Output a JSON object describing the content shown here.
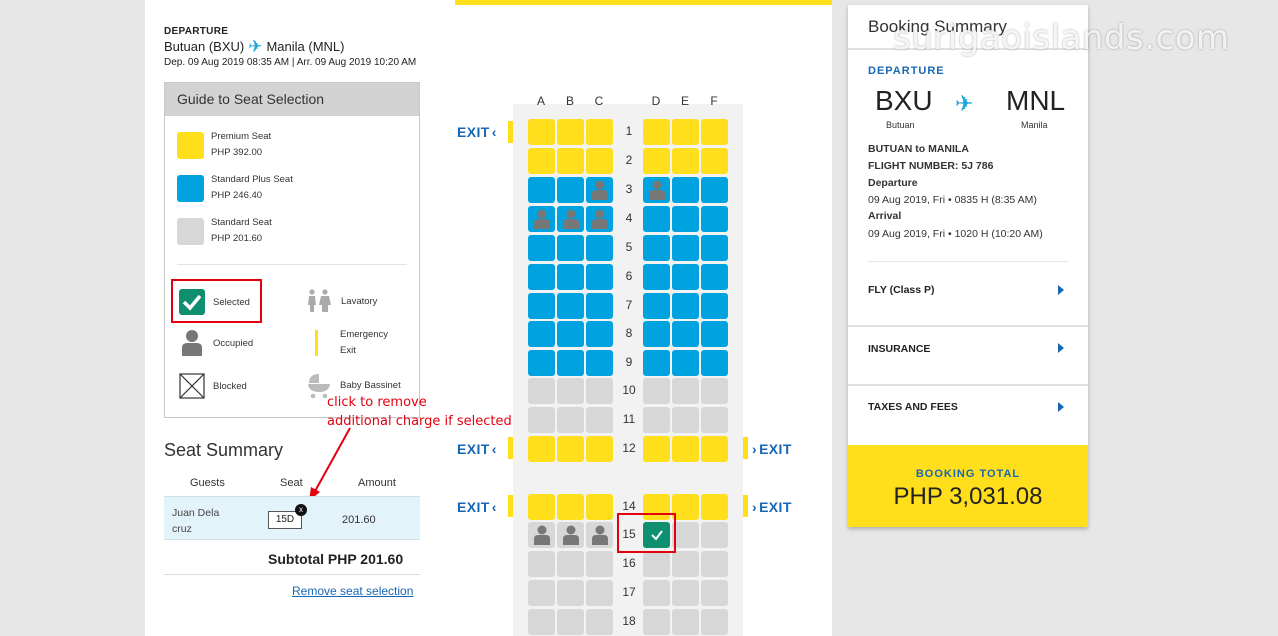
{
  "watermark": "surigaoislands.com",
  "departure": {
    "label": "DEPARTURE",
    "from": "Butuan (BXU)",
    "to": "Manila (MNL)",
    "times": "Dep. 09 Aug 2019 08:35 AM | Arr. 09 Aug 2019 10:20 AM"
  },
  "guide": {
    "title": "Guide to Seat Selection",
    "premium": {
      "name": "Premium Seat",
      "price": "PHP 392.00",
      "color": "#ffdf1b"
    },
    "plus": {
      "name": "Standard Plus Seat",
      "price": "PHP 246.40",
      "color": "#00a3e0"
    },
    "standard": {
      "name": "Standard Seat",
      "price": "PHP 201.60",
      "color": "#d7d7d7"
    },
    "selected": "Selected",
    "occupied": "Occupied",
    "blocked": "Blocked",
    "lavatory": "Lavatory",
    "emergency_line1": "Emergency",
    "emergency_line2": "Exit",
    "bassinet": "Baby Bassinet"
  },
  "annotation": {
    "line1": "click to remove",
    "line2": "additional charge if selected"
  },
  "seat_summary": {
    "title": "Seat Summary",
    "col_guests": "Guests",
    "col_seat": "Seat",
    "col_amount": "Amount",
    "guest_line1": "Juan Dela",
    "guest_line2": "cruz",
    "seat": "15D",
    "amount": "201.60",
    "subtotal": "Subtotal  PHP 201.60",
    "remove": "Remove seat selection"
  },
  "seat_map": {
    "columns": [
      "A",
      "B",
      "C",
      "D",
      "E",
      "F"
    ],
    "exit_label": "EXIT",
    "rows": [
      "1",
      "2",
      "3",
      "4",
      "5",
      "6",
      "7",
      "8",
      "9",
      "10",
      "11",
      "12",
      "14",
      "15",
      "16",
      "17",
      "18"
    ],
    "occupied": [
      "3C",
      "3D",
      "4A",
      "4B",
      "4C",
      "15A",
      "15B",
      "15C"
    ],
    "selected": "15D"
  },
  "booking": {
    "title": "Booking Summary",
    "dep_label": "DEPARTURE",
    "from_code": "BXU",
    "from_city": "Butuan",
    "to_code": "MNL",
    "to_city": "Manila",
    "route": "BUTUAN to MANILA",
    "flight": "FLIGHT NUMBER: 5J 786",
    "dep_title": "Departure",
    "dep_time": "09 Aug 2019, Fri • 0835 H (8:35 AM)",
    "arr_title": "Arrival",
    "arr_time": "09 Aug 2019, Fri • 1020 H (10:20 AM)",
    "fly": "FLY (Class P)",
    "insurance": "INSURANCE",
    "taxes": "TAXES AND FEES",
    "total_label": "BOOKING TOTAL",
    "total_value": "PHP 3,031.08"
  }
}
